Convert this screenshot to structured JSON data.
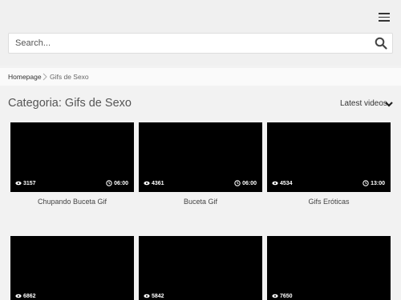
{
  "header": {
    "menu_icon": "hamburger-menu-icon",
    "search": {
      "placeholder": "Search...",
      "icon": "search-icon"
    }
  },
  "breadcrumb": {
    "home": "Homepage",
    "separator_icon": "chevron-right-icon",
    "current": "Gifs de Sexo"
  },
  "page": {
    "title": "Categoria: Gifs de Sexo",
    "sort_label": "Latest videos",
    "sort_icon": "chevron-down-icon"
  },
  "videos": [
    {
      "views": "3157",
      "duration": "06:00",
      "title": "Chupando Buceta Gif"
    },
    {
      "views": "4361",
      "duration": "06:00",
      "title": "Buceta Gif"
    },
    {
      "views": "4534",
      "duration": "13:00",
      "title": "Gifs Eróticas"
    },
    {
      "views": "6862",
      "duration": "",
      "title": ""
    },
    {
      "views": "5842",
      "duration": "",
      "title": ""
    },
    {
      "views": "7650",
      "duration": "",
      "title": ""
    }
  ],
  "colors": {
    "thumbnail": "#000000",
    "background": "#f2f2f2",
    "text": "#444444"
  }
}
